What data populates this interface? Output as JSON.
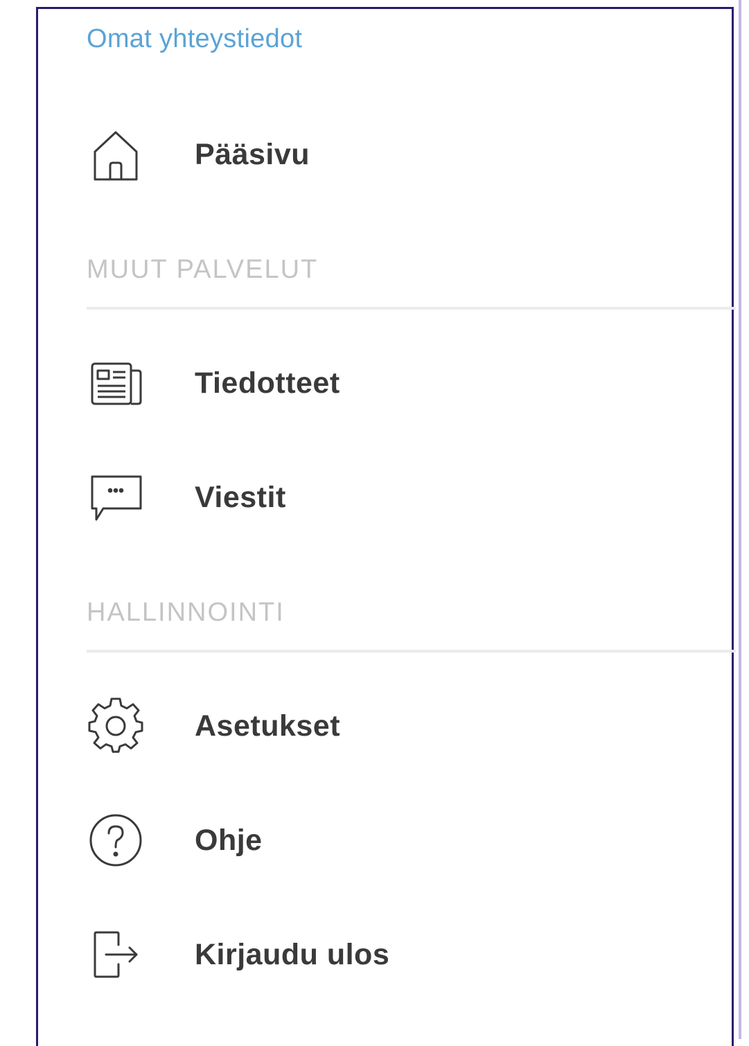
{
  "menu": {
    "profile_link": "Omat yhteystiedot",
    "items": [
      {
        "label": "Pääsivu",
        "icon": "home-icon"
      }
    ],
    "sections": [
      {
        "title": "MUUT PALVELUT",
        "items": [
          {
            "label": "Tiedotteet",
            "icon": "newspaper-icon"
          },
          {
            "label": "Viestit",
            "icon": "chat-bubble-icon"
          }
        ]
      },
      {
        "title": "HALLINNOINTI",
        "items": [
          {
            "label": "Asetukset",
            "icon": "gear-icon"
          },
          {
            "label": "Ohje",
            "icon": "help-icon"
          },
          {
            "label": "Kirjaudu ulos",
            "icon": "logout-icon"
          }
        ]
      }
    ]
  },
  "colors": {
    "link": "#5aa3d6",
    "label": "#3a3a3a",
    "section_header": "#c4c4c4",
    "frame": "#2b1a6e"
  }
}
